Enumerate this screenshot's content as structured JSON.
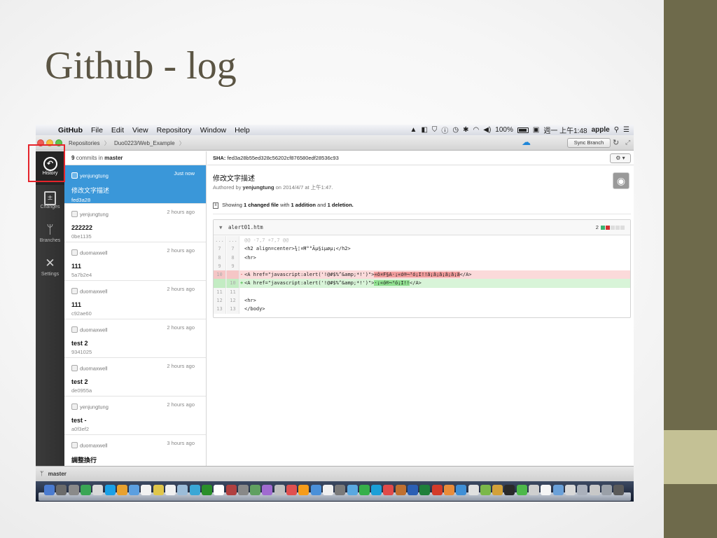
{
  "slide": {
    "title": "Github - log"
  },
  "menubar": {
    "app": "GitHub",
    "items": [
      "File",
      "Edit",
      "View",
      "Repository",
      "Window",
      "Help"
    ],
    "battery": "100%",
    "clock": "週一 上午1:48",
    "user": "apple"
  },
  "titlebar": {
    "breadcrumbs": [
      "Repositories",
      "Duo0223/Web_Example"
    ],
    "sync_label": "Sync Branch"
  },
  "nav": {
    "items": [
      {
        "label": "History",
        "icon": "history-icon",
        "active": true
      },
      {
        "label": "Changes",
        "icon": "changes-icon",
        "active": false
      },
      {
        "label": "Branches",
        "icon": "branches-icon",
        "active": false
      },
      {
        "label": "Settings",
        "icon": "settings-icon",
        "active": false
      }
    ]
  },
  "commits": {
    "count": "9",
    "count_suffix": "commits in",
    "branch": "master",
    "items": [
      {
        "author": "yenjungtung",
        "time": "Just now",
        "message": "修改文字描述",
        "sha": "fed3a28",
        "selected": true
      },
      {
        "author": "yenjungtung",
        "time": "2 hours ago",
        "message": "222222",
        "sha": "0be1135",
        "selected": false
      },
      {
        "author": "duomaxwell",
        "time": "2 hours ago",
        "message": "111",
        "sha": "5a7b2e4",
        "selected": false
      },
      {
        "author": "duomaxwell",
        "time": "2 hours ago",
        "message": "111",
        "sha": "c92ae60",
        "selected": false
      },
      {
        "author": "duomaxwell",
        "time": "2 hours ago",
        "message": "test 2",
        "sha": "9341025",
        "selected": false
      },
      {
        "author": "duomaxwell",
        "time": "2 hours ago",
        "message": "test 2",
        "sha": "de0955a",
        "selected": false
      },
      {
        "author": "yenjungtung",
        "time": "2 hours ago",
        "message": "test -",
        "sha": "a0f3ef2",
        "selected": false
      },
      {
        "author": "duomaxwell",
        "time": "3 hours ago",
        "message": "調整換行",
        "sha": "",
        "selected": false
      }
    ]
  },
  "detail": {
    "sha_label": "SHA:",
    "sha": "fed3a28b55ed328c56202cf876580edf28536c93",
    "gear_label": "⚙ ▾",
    "title": "修改文字描述",
    "authored_prefix": "Authored by",
    "author": "yenjungtung",
    "authored_date": "on 2014/4/7 at 上午1:47.",
    "summary_prefix": "Showing",
    "summary_files": "1 changed file",
    "summary_mid": "with",
    "summary_add": "1 addition",
    "summary_and": "and",
    "summary_del": "1 deletion."
  },
  "file": {
    "name": "alert01.htm",
    "changes": "2",
    "lines": [
      {
        "type": "hunk",
        "a": "...",
        "b": "...",
        "code": "@@ -7,7 +7,7 @@"
      },
      {
        "type": "ctx",
        "a": "7",
        "b": "7",
        "code": "<h2 align=center>¾¦¤Ħ°°Ãµ§iµøµ¡</h2>"
      },
      {
        "type": "ctx",
        "a": "8",
        "b": "8",
        "code": "<hr>"
      },
      {
        "type": "ctx",
        "a": "9",
        "b": "9",
        "code": ""
      },
      {
        "type": "del",
        "a": "10",
        "b": "",
        "code": "<A href=\"javascript:alert('!@#$%^&amp;*!')\">",
        "hl": "«ô¤F§A·¡«ó®¬³ó¡I!!ã¡ã¡ã¡ã¡ã¡ã",
        "tail": "</A>"
      },
      {
        "type": "add",
        "a": "",
        "b": "10",
        "code": "<A href=\"javascript:alert('!@#$%^&amp;*!')\">",
        "hl": "·¡«ó®¬³ó¡I!!",
        "tail": "</A>"
      },
      {
        "type": "ctx",
        "a": "11",
        "b": "11",
        "code": ""
      },
      {
        "type": "ctx",
        "a": "12",
        "b": "12",
        "code": "<hr>"
      },
      {
        "type": "ctx",
        "a": "13",
        "b": "13",
        "code": "</body>"
      }
    ]
  },
  "branchbar": {
    "branch": "master"
  }
}
